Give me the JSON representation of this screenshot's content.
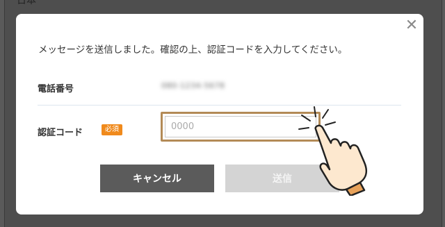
{
  "background": {
    "title_fragment": "日本"
  },
  "dialog": {
    "message": "メッセージを送信しました。確認の上、認証コードを入力してください。",
    "phone_label": "電話番号",
    "phone_value": "080-1234-5678",
    "code_label": "認証コード",
    "required_badge": "必須",
    "code_placeholder": "0000",
    "cancel_label": "キャンセル",
    "send_label": "送信",
    "close_icon": "close-icon"
  },
  "colors": {
    "required_badge": "#f08a1c",
    "input_highlight": "#b38a56",
    "cancel_button": "#5b5b5b",
    "send_button_disabled": "#d4d4d4"
  },
  "overlay": {
    "icon": "pointing-hand-icon"
  }
}
